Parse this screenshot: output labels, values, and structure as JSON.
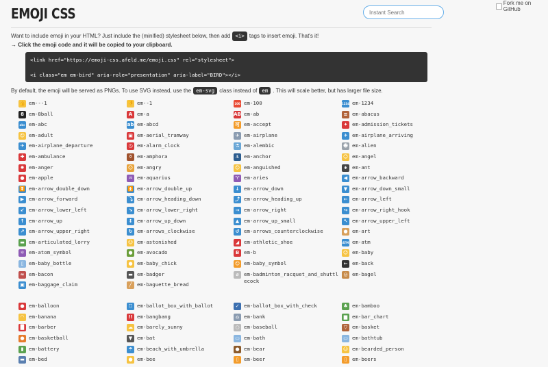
{
  "header": {
    "title": "EMOJI CSS",
    "search_placeholder": "Instant Search",
    "fork_label": "Fork me on GitHub"
  },
  "intro": {
    "text_before": "Want to include emoji in your HTML? Just include the (minified) stylesheet below, then add",
    "tag": "<i>",
    "text_after": "tags to insert emoji. That's it!",
    "line2": "→ Click the emoji code and it will be copied to your clipboard."
  },
  "code": {
    "line1": "<link href=\"https://emoji-css.afeld.me/emoji.css\" rel=\"stylesheet\">",
    "line2": "<i class=\"em em-bird\" aria-role=\"presentation\" aria-label=\"BIRD\"></i>"
  },
  "note": {
    "before": "By default, the emoji will be served as PNGs. To use SVG instead, use the",
    "svg_class": "em-svg",
    "middle": "class instead of",
    "em_class": "em",
    "after": ". This will scale better, but has larger file size."
  },
  "emojis_block1": [
    {
      "name": "em---1",
      "icon": "thumbs-up-icon",
      "glyph": "👍",
      "bg": "#f6c342"
    },
    {
      "name": "em--1",
      "icon": "thumbs-down-icon",
      "glyph": "👎",
      "bg": "#f6c342"
    },
    {
      "name": "em-100",
      "icon": "hundred-points-icon",
      "glyph": "100",
      "bg": "#e94b35"
    },
    {
      "name": "em-1234",
      "icon": "input-numbers-icon",
      "glyph": "1234",
      "bg": "#3b8ed0"
    },
    {
      "name": "em-8ball",
      "icon": "pool-8-ball-icon",
      "glyph": "8",
      "bg": "#222"
    },
    {
      "name": "em-a",
      "icon": "a-button-icon",
      "glyph": "A",
      "bg": "#d9383a"
    },
    {
      "name": "em-ab",
      "icon": "ab-button-icon",
      "glyph": "AB",
      "bg": "#d9383a"
    },
    {
      "name": "em-abacus",
      "icon": "abacus-icon",
      "glyph": "≡",
      "bg": "#b0633a"
    },
    {
      "name": "em-abc",
      "icon": "abc-icon",
      "glyph": "abc",
      "bg": "#3b8ed0"
    },
    {
      "name": "em-abcd",
      "icon": "abcd-icon",
      "glyph": "ab",
      "bg": "#3b8ed0"
    },
    {
      "name": "em-accept",
      "icon": "accept-icon",
      "glyph": "可",
      "bg": "#f39c2b"
    },
    {
      "name": "em-admission_tickets",
      "icon": "tickets-icon",
      "glyph": "✦",
      "bg": "#d9383a"
    },
    {
      "name": "em-adult",
      "icon": "adult-icon",
      "glyph": "☺",
      "bg": "#f6c342"
    },
    {
      "name": "em-aerial_tramway",
      "icon": "aerial-tramway-icon",
      "glyph": "▣",
      "bg": "#d9383a"
    },
    {
      "name": "em-airplane",
      "icon": "airplane-icon",
      "glyph": "✈",
      "bg": "#8a9bb0"
    },
    {
      "name": "em-airplane_arriving",
      "icon": "airplane-arriving-icon",
      "glyph": "✈",
      "bg": "#3b8ed0"
    },
    {
      "name": "em-airplane_departure",
      "icon": "airplane-departure-icon",
      "glyph": "✈",
      "bg": "#3b8ed0"
    },
    {
      "name": "em-alarm_clock",
      "icon": "alarm-clock-icon",
      "glyph": "◷",
      "bg": "#d9383a"
    },
    {
      "name": "em-alembic",
      "icon": "alembic-icon",
      "glyph": "⚗",
      "bg": "#6aa7d6"
    },
    {
      "name": "em-alien",
      "icon": "alien-icon",
      "glyph": "☻",
      "bg": "#9aa3ab"
    },
    {
      "name": "em-ambulance",
      "icon": "ambulance-icon",
      "glyph": "✚",
      "bg": "#d9383a"
    },
    {
      "name": "em-amphora",
      "icon": "amphora-icon",
      "glyph": "⚱",
      "bg": "#a0522d"
    },
    {
      "name": "em-anchor",
      "icon": "anchor-icon",
      "glyph": "⚓",
      "bg": "#2c5d8f"
    },
    {
      "name": "em-angel",
      "icon": "angel-icon",
      "glyph": "☺",
      "bg": "#f6c342"
    },
    {
      "name": "em-anger",
      "icon": "anger-icon",
      "glyph": "✹",
      "bg": "#d9383a"
    },
    {
      "name": "em-angry",
      "icon": "angry-face-icon",
      "glyph": "☹",
      "bg": "#e8a33b"
    },
    {
      "name": "em-anguished",
      "icon": "anguished-face-icon",
      "glyph": "☹",
      "bg": "#f6c342"
    },
    {
      "name": "em-ant",
      "icon": "ant-icon",
      "glyph": "∗",
      "bg": "#444"
    },
    {
      "name": "em-apple",
      "icon": "apple-icon",
      "glyph": "●",
      "bg": "#d9383a"
    },
    {
      "name": "em-aquarius",
      "icon": "aquarius-icon",
      "glyph": "♒",
      "bg": "#8e5bb5"
    },
    {
      "name": "em-aries",
      "icon": "aries-icon",
      "glyph": "♈",
      "bg": "#8e5bb5"
    },
    {
      "name": "em-arrow_backward",
      "icon": "arrow-backward-icon",
      "glyph": "◀",
      "bg": "#3b8ed0"
    },
    {
      "name": "em-arrow_double_down",
      "icon": "arrow-double-down-icon",
      "glyph": "⏬",
      "bg": "#3b8ed0"
    },
    {
      "name": "em-arrow_double_up",
      "icon": "arrow-double-up-icon",
      "glyph": "⏫",
      "bg": "#3b8ed0"
    },
    {
      "name": "em-arrow_down",
      "icon": "arrow-down-icon",
      "glyph": "↓",
      "bg": "#3b8ed0"
    },
    {
      "name": "em-arrow_down_small",
      "icon": "arrow-down-small-icon",
      "glyph": "▼",
      "bg": "#3b8ed0"
    },
    {
      "name": "em-arrow_forward",
      "icon": "arrow-forward-icon",
      "glyph": "▶",
      "bg": "#3b8ed0"
    },
    {
      "name": "em-arrow_heading_down",
      "icon": "arrow-heading-down-icon",
      "glyph": "⤵",
      "bg": "#3b8ed0"
    },
    {
      "name": "em-arrow_heading_up",
      "icon": "arrow-heading-up-icon",
      "glyph": "⤴",
      "bg": "#3b8ed0"
    },
    {
      "name": "em-arrow_left",
      "icon": "arrow-left-icon",
      "glyph": "←",
      "bg": "#3b8ed0"
    },
    {
      "name": "em-arrow_lower_left",
      "icon": "arrow-lower-left-icon",
      "glyph": "↙",
      "bg": "#3b8ed0"
    },
    {
      "name": "em-arrow_lower_right",
      "icon": "arrow-lower-right-icon",
      "glyph": "↘",
      "bg": "#3b8ed0"
    },
    {
      "name": "em-arrow_right",
      "icon": "arrow-right-icon",
      "glyph": "→",
      "bg": "#3b8ed0"
    },
    {
      "name": "em-arrow_right_hook",
      "icon": "arrow-right-hook-icon",
      "glyph": "↪",
      "bg": "#3b8ed0"
    },
    {
      "name": "em-arrow_up",
      "icon": "arrow-up-icon",
      "glyph": "↑",
      "bg": "#3b8ed0"
    },
    {
      "name": "em-arrow_up_down",
      "icon": "arrow-up-down-icon",
      "glyph": "↕",
      "bg": "#3b8ed0"
    },
    {
      "name": "em-arrow_up_small",
      "icon": "arrow-up-small-icon",
      "glyph": "▲",
      "bg": "#3b8ed0"
    },
    {
      "name": "em-arrow_upper_left",
      "icon": "arrow-upper-left-icon",
      "glyph": "↖",
      "bg": "#3b8ed0"
    },
    {
      "name": "em-arrow_upper_right",
      "icon": "arrow-upper-right-icon",
      "glyph": "↗",
      "bg": "#3b8ed0"
    },
    {
      "name": "em-arrows_clockwise",
      "icon": "arrows-clockwise-icon",
      "glyph": "↻",
      "bg": "#3b8ed0"
    },
    {
      "name": "em-arrows_counterclockwise",
      "icon": "arrows-counterclockwise-icon",
      "glyph": "↺",
      "bg": "#3b8ed0"
    },
    {
      "name": "em-art",
      "icon": "art-palette-icon",
      "glyph": "●",
      "bg": "#d9a05b"
    },
    {
      "name": "em-articulated_lorry",
      "icon": "articulated-lorry-icon",
      "glyph": "▬",
      "bg": "#5aa14f"
    },
    {
      "name": "em-astonished",
      "icon": "astonished-face-icon",
      "glyph": "☺",
      "bg": "#f6c342"
    },
    {
      "name": "em-athletic_shoe",
      "icon": "athletic-shoe-icon",
      "glyph": "◢",
      "bg": "#d9383a"
    },
    {
      "name": "em-atm",
      "icon": "atm-icon",
      "glyph": "ATM",
      "bg": "#3b8ed0"
    },
    {
      "name": "em-atom_symbol",
      "icon": "atom-symbol-icon",
      "glyph": "⚛",
      "bg": "#8e5bb5"
    },
    {
      "name": "em-avocado",
      "icon": "avocado-icon",
      "glyph": "●",
      "bg": "#6b9e3a"
    },
    {
      "name": "em-b",
      "icon": "b-button-icon",
      "glyph": "B",
      "bg": "#d9383a"
    },
    {
      "name": "em-baby",
      "icon": "baby-icon",
      "glyph": "☺",
      "bg": "#f6c342"
    },
    {
      "name": "em-baby_bottle",
      "icon": "baby-bottle-icon",
      "glyph": "▯",
      "bg": "#8ab6e0"
    },
    {
      "name": "em-baby_chick",
      "icon": "baby-chick-icon",
      "glyph": "●",
      "bg": "#f6c342"
    },
    {
      "name": "em-baby_symbol",
      "icon": "baby-symbol-icon",
      "glyph": "☺",
      "bg": "#f39c2b"
    },
    {
      "name": "em-back",
      "icon": "back-arrow-icon",
      "glyph": "←",
      "bg": "#333"
    },
    {
      "name": "em-bacon",
      "icon": "bacon-icon",
      "glyph": "≈",
      "bg": "#c0504d"
    },
    {
      "name": "em-badger",
      "icon": "badger-icon",
      "glyph": "▬",
      "bg": "#555"
    },
    {
      "name": "em-badminton_racquet_and_shuttlecock",
      "icon": "badminton-icon",
      "glyph": "⌀",
      "bg": "#bbb",
      "tall": true
    },
    {
      "name": "em-bagel",
      "icon": "bagel-icon",
      "glyph": "◎",
      "bg": "#c78b4a"
    },
    {
      "name": "em-baggage_claim",
      "icon": "baggage-claim-icon",
      "glyph": "▣",
      "bg": "#3b8ed0"
    },
    {
      "name": "em-baguette_bread",
      "icon": "baguette-bread-icon",
      "glyph": "╱",
      "bg": "#d9a05b"
    }
  ],
  "emojis_block2": [
    {
      "name": "em-balloon",
      "icon": "balloon-icon",
      "glyph": "●",
      "bg": "#d9383a"
    },
    {
      "name": "em-ballot_box_with_ballot",
      "icon": "ballot-box-icon",
      "glyph": "☐",
      "bg": "#3b8ed0"
    },
    {
      "name": "em-ballot_box_with_check",
      "icon": "ballot-box-check-icon",
      "glyph": "✓",
      "bg": "#3b6fb0"
    },
    {
      "name": "em-bamboo",
      "icon": "bamboo-icon",
      "glyph": "♣",
      "bg": "#5aa14f"
    },
    {
      "name": "em-banana",
      "icon": "banana-icon",
      "glyph": "◠",
      "bg": "#f6c342"
    },
    {
      "name": "em-bangbang",
      "icon": "double-exclamation-icon",
      "glyph": "!!",
      "bg": "#d9383a"
    },
    {
      "name": "em-bank",
      "icon": "bank-icon",
      "glyph": "⌂",
      "bg": "#8a9bb0"
    },
    {
      "name": "em-bar_chart",
      "icon": "bar-chart-icon",
      "glyph": "▆",
      "bg": "#5aa14f"
    },
    {
      "name": "em-barber",
      "icon": "barber-pole-icon",
      "glyph": "█",
      "bg": "#d9383a"
    },
    {
      "name": "em-barely_sunny",
      "icon": "barely-sunny-icon",
      "glyph": "☁",
      "bg": "#f6c342"
    },
    {
      "name": "em-baseball",
      "icon": "baseball-icon",
      "glyph": "○",
      "bg": "#bbb"
    },
    {
      "name": "em-basket",
      "icon": "basket-icon",
      "glyph": "▽",
      "bg": "#b0633a"
    },
    {
      "name": "em-basketball",
      "icon": "basketball-icon",
      "glyph": "●",
      "bg": "#e57a2b"
    },
    {
      "name": "em-bat",
      "icon": "bat-icon",
      "glyph": "▼",
      "bg": "#555"
    },
    {
      "name": "em-bath",
      "icon": "bath-icon",
      "glyph": "▭",
      "bg": "#8ab6e0"
    },
    {
      "name": "em-bathtub",
      "icon": "bathtub-icon",
      "glyph": "▭",
      "bg": "#8ab6e0"
    },
    {
      "name": "em-battery",
      "icon": "battery-icon",
      "glyph": "▮",
      "bg": "#5aa14f"
    },
    {
      "name": "em-beach_with_umbrella",
      "icon": "beach-umbrella-icon",
      "glyph": "☂",
      "bg": "#3b8ed0"
    },
    {
      "name": "em-bear",
      "icon": "bear-icon",
      "glyph": "●",
      "bg": "#8b5a2b"
    },
    {
      "name": "em-bearded_person",
      "icon": "bearded-person-icon",
      "glyph": "☺",
      "bg": "#f6c342"
    },
    {
      "name": "em-bed",
      "icon": "bed-icon",
      "glyph": "▬",
      "bg": "#5a7fb0"
    },
    {
      "name": "em-bee",
      "icon": "bee-icon",
      "glyph": "●",
      "bg": "#f6c342"
    },
    {
      "name": "em-beer",
      "icon": "beer-icon",
      "glyph": "▯",
      "bg": "#f39c2b"
    },
    {
      "name": "em-beers",
      "icon": "beers-icon",
      "glyph": "▯",
      "bg": "#f39c2b"
    }
  ]
}
